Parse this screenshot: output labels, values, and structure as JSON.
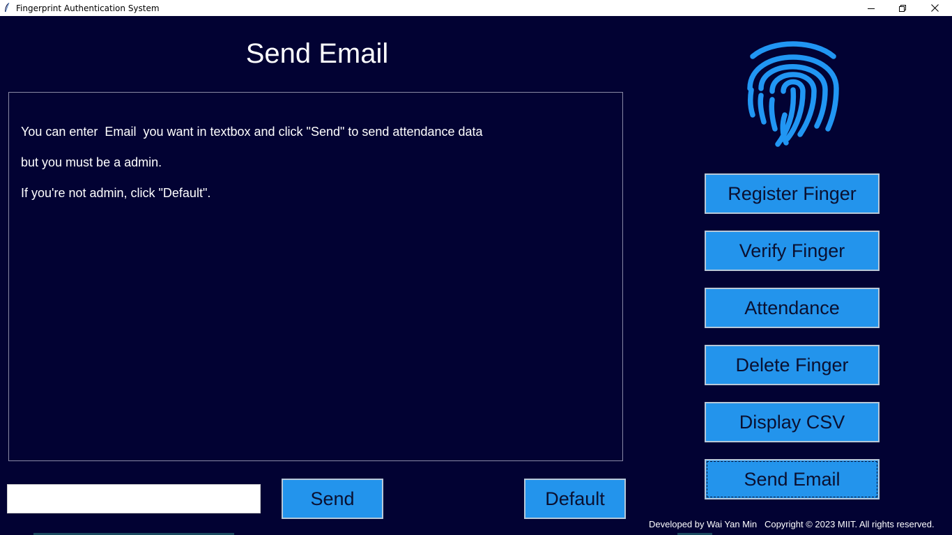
{
  "window": {
    "title": "Fingerprint Authentication System",
    "icon": "feather-icon",
    "controls": [
      "minimize-icon",
      "restore-icon",
      "close-icon"
    ]
  },
  "main": {
    "title": "Send Email",
    "message_lines": [
      "You can enter  Email  you want in textbox and click \"Send\" to send attendance data",
      "but you must be a admin.",
      "If you're not admin, click \"Default\"."
    ],
    "email_input": {
      "value": "",
      "placeholder": ""
    },
    "send_label": "Send",
    "default_label": "Default"
  },
  "sidebar": {
    "logo_icon": "fingerprint-icon",
    "buttons": [
      {
        "label": "Register Finger"
      },
      {
        "label": "Verify Finger"
      },
      {
        "label": "Attendance"
      },
      {
        "label": "Delete Finger"
      },
      {
        "label": "Display CSV"
      },
      {
        "label": "Send Email",
        "active": true
      }
    ]
  },
  "footer": {
    "text": "Developed by Wai Yan Min   Copyright © 2023 MIIT. All rights reserved."
  },
  "colors": {
    "background": "#020233",
    "button": "#2394ec",
    "button_text": "#0a1030",
    "fingerprint": "#2196f3",
    "text": "#ffffff"
  }
}
